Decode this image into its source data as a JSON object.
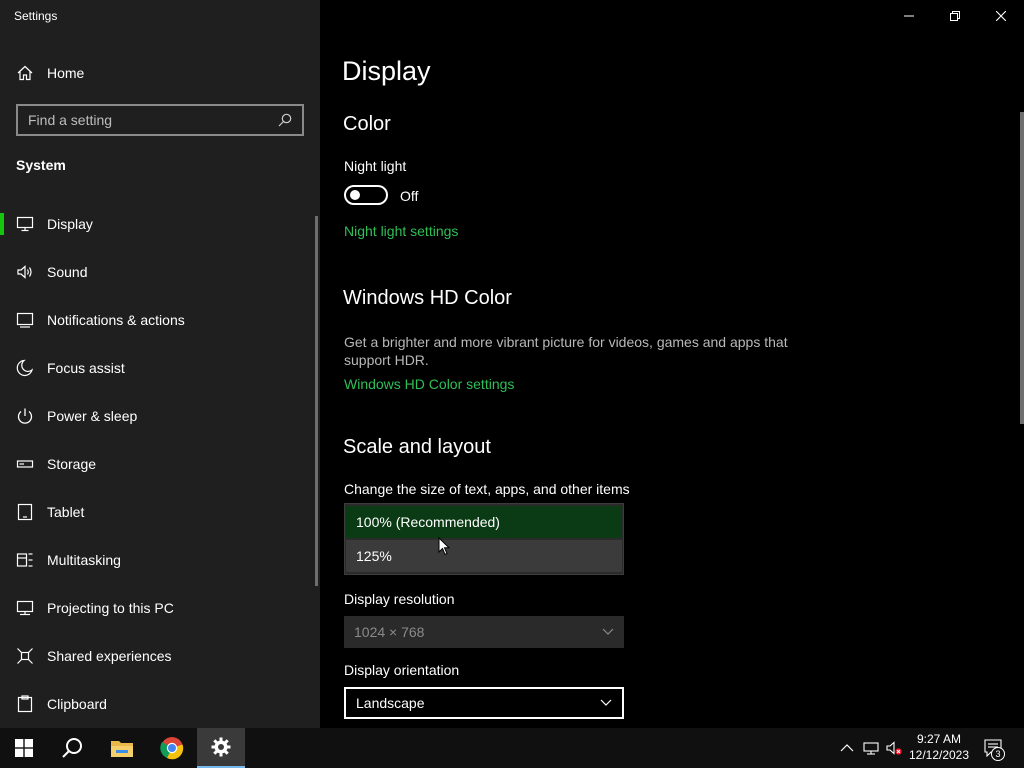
{
  "window": {
    "title": "Settings",
    "controls": [
      "minimize",
      "maximize",
      "close"
    ]
  },
  "sidebar": {
    "home_label": "Home",
    "search": {
      "placeholder": "Find a setting",
      "value": ""
    },
    "section_label": "System",
    "items": [
      {
        "label": "Display",
        "icon": "monitor-icon",
        "active": true
      },
      {
        "label": "Sound",
        "icon": "speaker-icon"
      },
      {
        "label": "Notifications & actions",
        "icon": "notification-icon"
      },
      {
        "label": "Focus assist",
        "icon": "moon-icon"
      },
      {
        "label": "Power & sleep",
        "icon": "power-icon"
      },
      {
        "label": "Storage",
        "icon": "storage-icon"
      },
      {
        "label": "Tablet",
        "icon": "tablet-icon"
      },
      {
        "label": "Multitasking",
        "icon": "multitasking-icon"
      },
      {
        "label": "Projecting to this PC",
        "icon": "projecting-icon"
      },
      {
        "label": "Shared experiences",
        "icon": "shared-icon"
      },
      {
        "label": "Clipboard",
        "icon": "clipboard-icon"
      }
    ]
  },
  "main": {
    "page_title": "Display",
    "color": {
      "heading": "Color",
      "night_light_label": "Night light",
      "night_light_state": "Off",
      "night_light_link": "Night light settings"
    },
    "hdr": {
      "heading": "Windows HD Color",
      "description": "Get a brighter and more vibrant picture for videos, games and apps that support HDR.",
      "link": "Windows HD Color settings"
    },
    "scale": {
      "heading": "Scale and layout",
      "size_label": "Change the size of text, apps, and other items",
      "options": [
        "100% (Recommended)",
        "125%"
      ],
      "selected": "100% (Recommended)",
      "resolution_label": "Display resolution",
      "resolution_value": "1024 × 768",
      "orientation_label": "Display orientation",
      "orientation_value": "Landscape"
    }
  },
  "taskbar": {
    "apps": [
      "start-icon",
      "search-icon",
      "file-explorer-icon",
      "chrome-icon",
      "settings-icon"
    ],
    "active_app": "settings-icon",
    "time": "9:27 AM",
    "date": "12/12/2023",
    "notification_count": "3"
  },
  "colors": {
    "accent": "#16c60c",
    "link": "#2fbf56",
    "selected_option": "#0b3b14",
    "sidebar_bg": "#1f1f1f"
  }
}
